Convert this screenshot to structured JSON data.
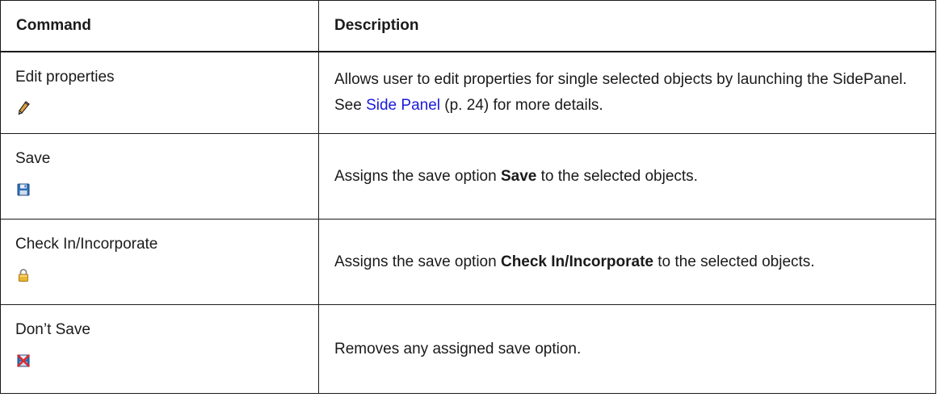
{
  "table": {
    "headers": {
      "command": "Command",
      "description": "Description"
    },
    "rows": [
      {
        "command": "Edit properties",
        "icon": "pencil-icon",
        "description": {
          "pre": "Allows user to edit properties for single selected objects by launching the SidePanel. See ",
          "link": "Side Panel",
          "post": " (p. 24) for more details."
        }
      },
      {
        "command": "Save",
        "icon": "floppy-disk-icon",
        "description": {
          "pre": "Assigns the save option ",
          "bold": "Save",
          "post": " to the selected objects."
        }
      },
      {
        "command": "Check In/Incorporate",
        "icon": "padlock-icon",
        "description": {
          "pre": "Assigns the save option ",
          "bold": "Check In/Incorporate",
          "post": " to the selected objects."
        }
      },
      {
        "command": "Don’t Save",
        "icon": "dont-save-icon",
        "description": {
          "text": "Removes any assigned save option."
        }
      }
    ]
  },
  "colors": {
    "link": "#1a1adc",
    "border": "#1a1a1a"
  }
}
